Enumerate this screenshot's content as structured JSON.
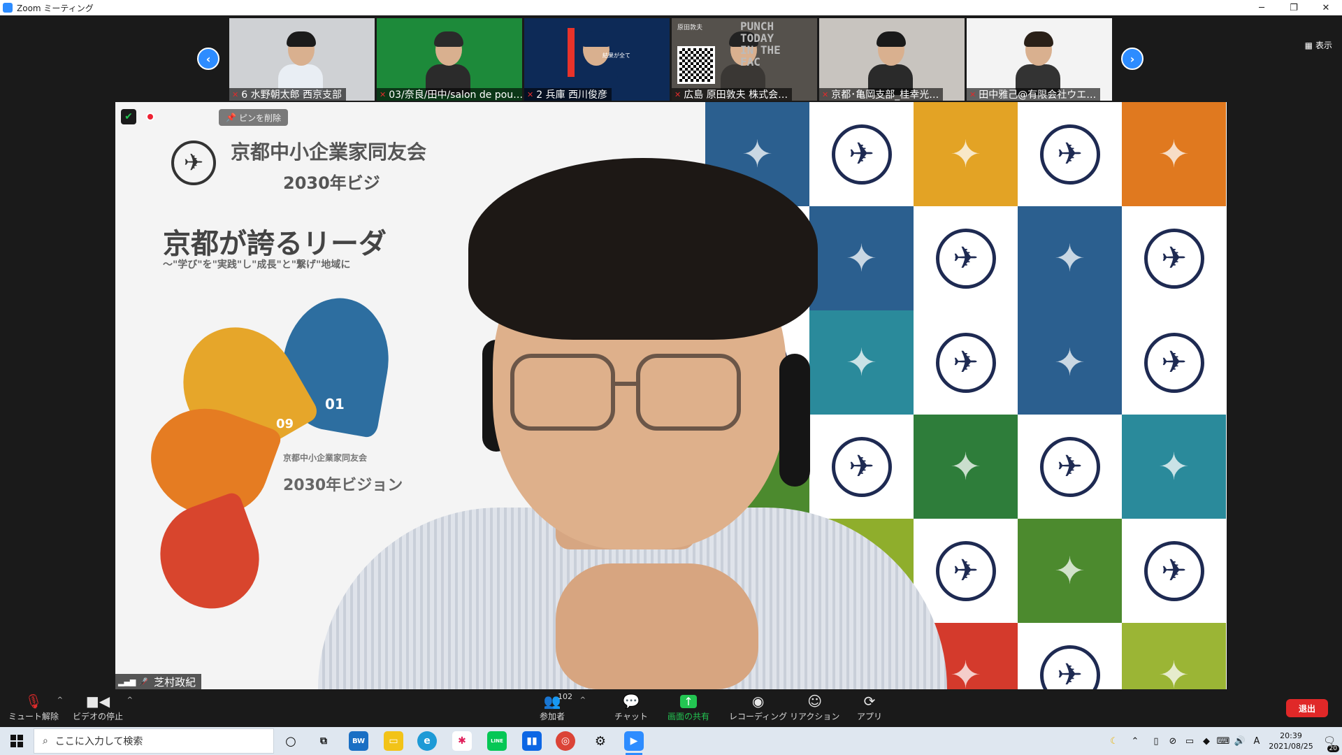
{
  "window": {
    "title": "Zoom ミーティング",
    "controls": {
      "minimize": "─",
      "restore": "❐",
      "close": "✕"
    }
  },
  "strip": {
    "prev": "‹",
    "next": "›",
    "view_label": "表示",
    "participants": [
      {
        "name": "6 水野朝太郎 西京支部",
        "bg": "#cfd1d4",
        "shirt": "#e9eef4",
        "hair": "#1b1b1b"
      },
      {
        "name": "03/奈良/田中/salon de pou…",
        "bg": "#1d8a3a",
        "shirt": "#2b2b2b",
        "hair": "#2a2a2a"
      },
      {
        "name": "2 兵庫 西川俊彦",
        "bg": "#0d2a57",
        "shirt": "#0d2a57",
        "hair": "#0d2a57"
      },
      {
        "name": "広島 原田敦夫 株式会…",
        "bg": "#55514c",
        "shirt": "#3a3734",
        "hair": "#222"
      },
      {
        "name": "京都･亀岡支部_桂幸光…",
        "bg": "#c8c4bf",
        "shirt": "#2a2a2a",
        "hair": "#1a1a1a"
      },
      {
        "name": "田中雅己@有限会社ウエ…",
        "bg": "#f3f3f3",
        "shirt": "#333",
        "hair": "#2a2018"
      }
    ],
    "thumb_texts": {
      "kobe_caption": "結果が全て",
      "punch_lines": [
        "PUNCH",
        "TODAY",
        "IN THE",
        "FAC"
      ],
      "harada_tag": "原田敦夫"
    }
  },
  "main": {
    "pin_label": "ピンを削除",
    "speaker_name": "芝村政紀",
    "slide": {
      "org": "京都中小企業家同友会",
      "vision": "2030年ビジ",
      "headline": "京都が誇るリーダ",
      "sub": "〜\"学び\"を\"実践\"し\"成長\"と\"繋げ\"地域に",
      "center1": "京都中小企業家同友会",
      "center2": "2030年ビジョン",
      "num1": "01",
      "num2": "09"
    },
    "grid_colors": [
      "#2b5f8f",
      "#ffffff",
      "#e3a325",
      "#ffffff",
      "#e0791f",
      "#ffffff",
      "#2b5f8f",
      "#ffffff",
      "#2b5f8f",
      "#ffffff",
      "#ffffff",
      "#2a8a9b",
      "#ffffff",
      "#2b5f8f",
      "#ffffff",
      "#4c8a2e",
      "#ffffff",
      "#2e7d3a",
      "#ffffff",
      "#2a8a9b",
      "#ffffff",
      "#8fae2c",
      "#ffffff",
      "#4c8a2e",
      "#ffffff",
      "#ffffff",
      "#ffffff",
      "#d43a2c",
      "#ffffff",
      "#9bb535"
    ]
  },
  "toolbar": {
    "mute": "ミュート解除",
    "video": "ビデオの停止",
    "participants": "参加者",
    "participant_count": "102",
    "chat": "チャット",
    "share": "画面の共有",
    "record": "レコーディング",
    "reaction": "リアクション",
    "apps": "アプリ",
    "leave": "退出",
    "caret": "^"
  },
  "taskbar": {
    "search_placeholder": "ここに入力して検索",
    "time": "20:39",
    "date": "2021/08/25",
    "ime": "A",
    "notify_count": "20",
    "icons": [
      "BW",
      "LINE"
    ]
  }
}
